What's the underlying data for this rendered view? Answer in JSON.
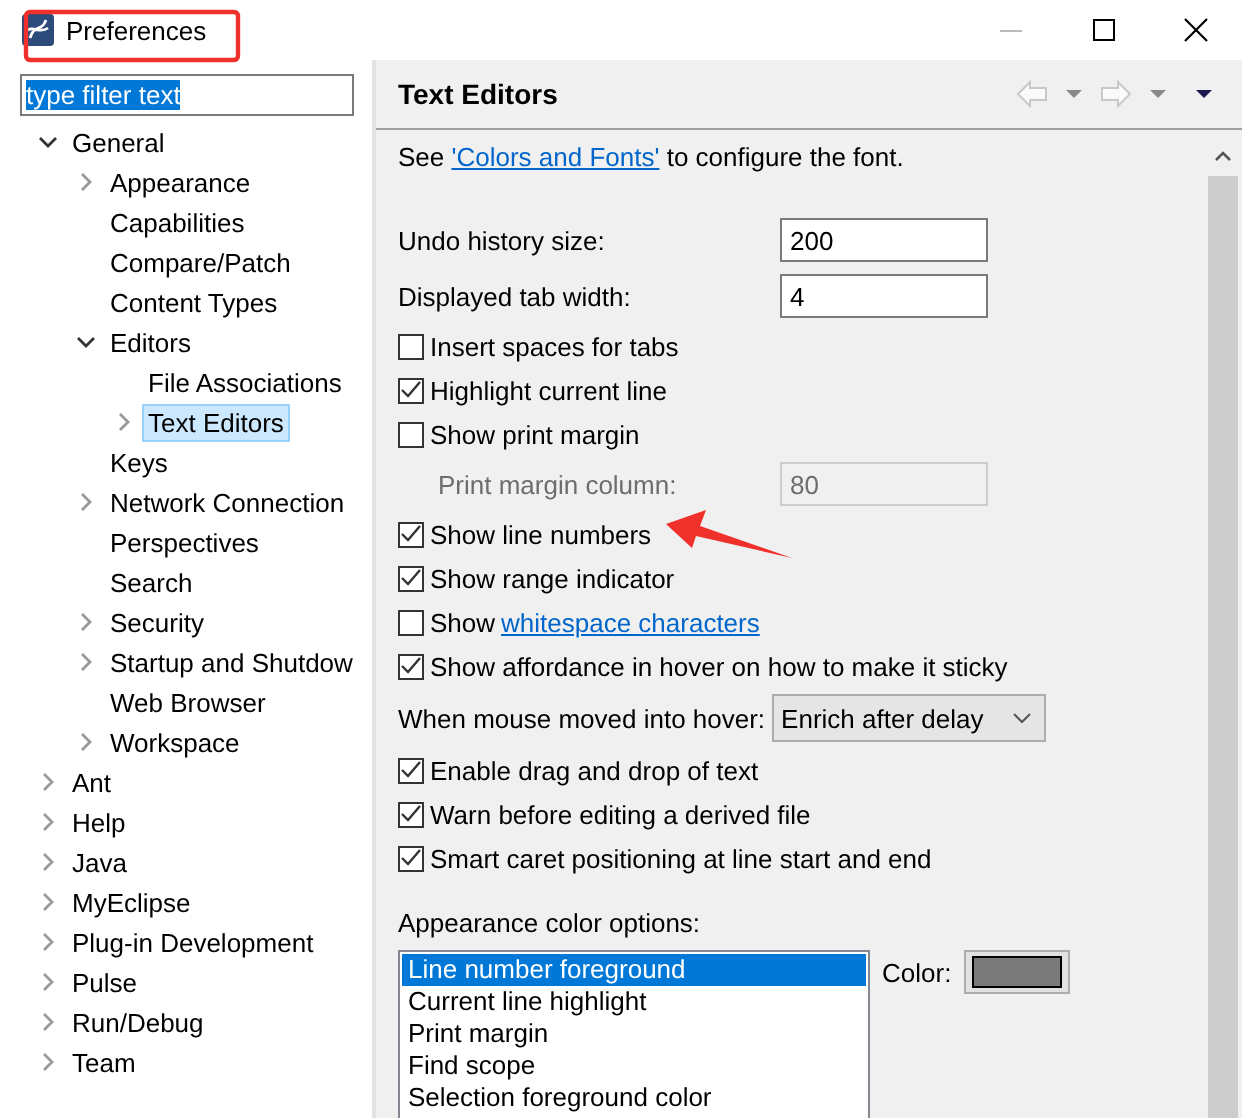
{
  "window": {
    "title": "Preferences"
  },
  "filter": {
    "value": "type filter text",
    "text_selected": true
  },
  "tree": [
    {
      "label": "General",
      "kind": "folder",
      "expanded": true,
      "selected": false,
      "children": [
        {
          "label": "Appearance",
          "kind": "folder",
          "expanded": false,
          "selected": false
        },
        {
          "label": "Capabilities",
          "kind": "leaf",
          "selected": false
        },
        {
          "label": "Compare/Patch",
          "kind": "leaf",
          "selected": false
        },
        {
          "label": "Content Types",
          "kind": "leaf",
          "selected": false
        },
        {
          "label": "Editors",
          "kind": "folder",
          "expanded": true,
          "selected": false,
          "children": [
            {
              "label": "File Associations",
              "kind": "leaf",
              "selected": false
            },
            {
              "label": "Text Editors",
              "kind": "folder",
              "expanded": false,
              "selected": true
            }
          ]
        },
        {
          "label": "Keys",
          "kind": "leaf",
          "selected": false
        },
        {
          "label": "Network Connection",
          "kind": "folder",
          "expanded": false,
          "selected": false
        },
        {
          "label": "Perspectives",
          "kind": "leaf",
          "selected": false
        },
        {
          "label": "Search",
          "kind": "leaf",
          "selected": false
        },
        {
          "label": "Security",
          "kind": "folder",
          "expanded": false,
          "selected": false
        },
        {
          "label": "Startup and Shutdow",
          "kind": "folder",
          "expanded": false,
          "selected": false
        },
        {
          "label": "Web Browser",
          "kind": "leaf",
          "selected": false
        },
        {
          "label": "Workspace",
          "kind": "folder",
          "expanded": false,
          "selected": false
        }
      ]
    },
    {
      "label": "Ant",
      "kind": "folder",
      "expanded": false,
      "selected": false
    },
    {
      "label": "Help",
      "kind": "folder",
      "expanded": false,
      "selected": false
    },
    {
      "label": "Java",
      "kind": "folder",
      "expanded": false,
      "selected": false
    },
    {
      "label": "MyEclipse",
      "kind": "folder",
      "expanded": false,
      "selected": false
    },
    {
      "label": "Plug-in Development",
      "kind": "folder",
      "expanded": false,
      "selected": false
    },
    {
      "label": "Pulse",
      "kind": "folder",
      "expanded": false,
      "selected": false
    },
    {
      "label": "Run/Debug",
      "kind": "folder",
      "expanded": false,
      "selected": false
    },
    {
      "label": "Team",
      "kind": "folder",
      "expanded": false,
      "selected": false
    }
  ],
  "page": {
    "title": "Text Editors",
    "intro": {
      "prefix": "See",
      "link": "'Colors and Fonts'",
      "suffix": "to configure the font."
    },
    "options": [
      {
        "kind": "text-field",
        "label": "Undo history size:",
        "value": "200"
      },
      {
        "kind": "text-field",
        "label": "Displayed tab width:",
        "value": "4"
      },
      {
        "kind": "checkbox",
        "label": "Insert spaces for tabs",
        "checked": false
      },
      {
        "kind": "checkbox",
        "label": "Highlight current line",
        "checked": true
      },
      {
        "kind": "checkbox",
        "label": "Show print margin",
        "checked": false
      },
      {
        "kind": "disabled-field",
        "label": "Print margin column:",
        "value": "80"
      },
      {
        "kind": "checkbox",
        "label": "Show line numbers",
        "checked": true
      },
      {
        "kind": "checkbox",
        "label": "Show range indicator",
        "checked": true
      },
      {
        "kind": "checkbox",
        "label": "Show",
        "link": "whitespace characters",
        "checked": false
      },
      {
        "kind": "checkbox",
        "label": "Show affordance in hover on how to make it sticky",
        "checked": true
      },
      {
        "kind": "dropdown",
        "label": "When mouse moved into hover:",
        "value": "Enrich after delay"
      },
      {
        "kind": "checkbox",
        "label": "Enable drag and drop of text",
        "checked": true
      },
      {
        "kind": "checkbox",
        "label": "Warn before editing a derived file",
        "checked": true
      },
      {
        "kind": "checkbox",
        "label": "Smart caret positioning at line start and end",
        "checked": true
      }
    ],
    "color_options": {
      "label": "Appearance color options:",
      "items": [
        {
          "label": "Line number foreground",
          "selected": true
        },
        {
          "label": "Current line highlight",
          "selected": false
        },
        {
          "label": "Print margin",
          "selected": false
        },
        {
          "label": "Find scope",
          "selected": false
        },
        {
          "label": "Selection foreground color",
          "selected": false
        }
      ],
      "color_label": "Color:"
    }
  },
  "annotations": {
    "title_box": true,
    "pointer_arrow": true
  }
}
